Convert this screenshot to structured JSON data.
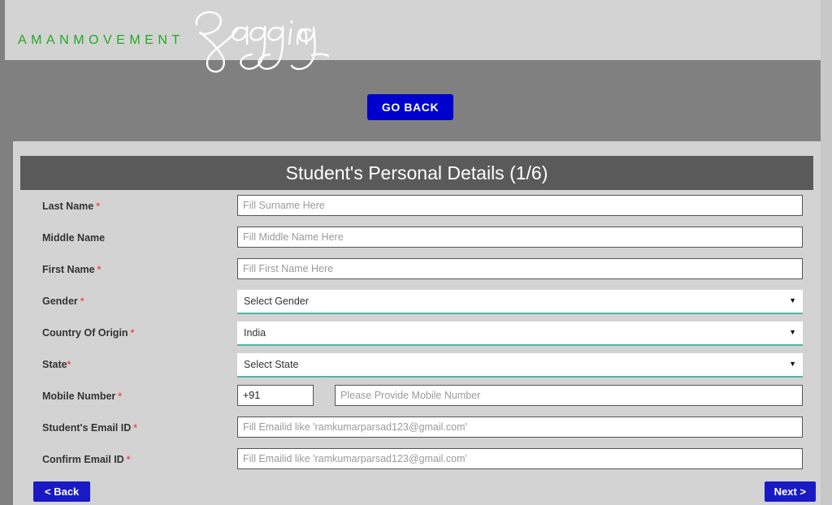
{
  "header": {
    "brand_name": "AMANMOVEMENT",
    "script_logo": "Ragging"
  },
  "goback": {
    "label": "GO BACK"
  },
  "form": {
    "title": "Student's Personal Details (1/6)",
    "fields": [
      {
        "label": "Last Name",
        "required": true,
        "required_spacing": "spaced",
        "type": "text",
        "placeholder": "Fill Surname Here",
        "value": ""
      },
      {
        "label": "Middle Name",
        "required": false,
        "required_spacing": "spaced",
        "type": "text",
        "placeholder": "Fill Middle Name Here",
        "value": ""
      },
      {
        "label": "First Name",
        "required": true,
        "required_spacing": "spaced",
        "type": "text",
        "placeholder": "Fill First Name Here",
        "value": ""
      },
      {
        "label": "Gender",
        "required": true,
        "required_spacing": "spaced",
        "type": "select",
        "selected": "Select Gender",
        "arrow": "▼"
      },
      {
        "label": "Country Of Origin",
        "required": true,
        "required_spacing": "spaced",
        "type": "select",
        "selected": "India",
        "arrow": "▼"
      },
      {
        "label": "State",
        "required": true,
        "required_spacing": "tight",
        "type": "select",
        "selected": "Select State",
        "arrow": "▼"
      },
      {
        "label": "Mobile Number",
        "required": true,
        "required_spacing": "spaced",
        "type": "mobile",
        "country_code": "+91",
        "placeholder": "Please Provide Mobile Number",
        "value": ""
      },
      {
        "label": "Student's Email ID",
        "required": true,
        "required_spacing": "spaced",
        "type": "text",
        "placeholder": "Fill Emailid like 'ramkumarparsad123@gmail.com'",
        "value": ""
      },
      {
        "label": "Confirm Email ID",
        "required": true,
        "required_spacing": "spaced",
        "type": "text",
        "placeholder": "Fill Emailid like 'ramkumarparsad123@gmail.com'",
        "value": ""
      }
    ]
  },
  "nav": {
    "back_label": "< Back",
    "next_label": "Next >"
  },
  "colors": {
    "page_background": "#808080",
    "band_background": "#d3d3d3",
    "title_bar": "#5a5a5a",
    "brand_green": "#22aa22",
    "button_blue": "#0000cc",
    "nav_blue": "#1a1ac4",
    "select_underline": "#4db6ac",
    "required_red": "#e8544a"
  }
}
